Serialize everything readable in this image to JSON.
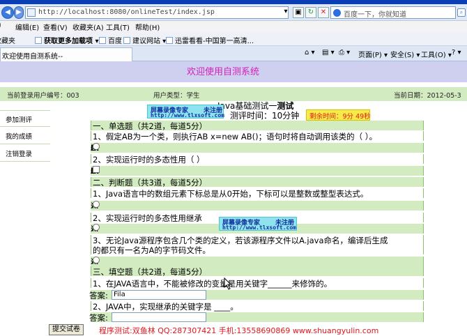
{
  "browser": {
    "url": "http://localhost:8080/onlineTest/index.jsp",
    "search_placeholder": "百度一下，你就知道",
    "menu": [
      "编辑(E)",
      "查看(V)",
      "收藏夹(A)",
      "工具(T)",
      "帮助(H)"
    ],
    "favorites": [
      "收藏夹",
      "获取更多加载项",
      "百度",
      "建议网站",
      "迅雷看看-中国第一高清..."
    ],
    "tab_title": "欢迎使用自测系统--",
    "tools": [
      "页面(P)",
      "安全(S)",
      "工具(O)"
    ]
  },
  "page": {
    "banner": "欢迎使用自测系统",
    "user_id_label": "当前登录用户编号：003",
    "user_type_label": "用户类型：学生",
    "date_label": "当前日期：2012-05-3",
    "sidebar": [
      "参加测评",
      "我的成绩",
      "注销登录"
    ],
    "test_title_prefix": "Java基础测试一",
    "test_title_suffix": "测试",
    "test_time": "测评时间：10分钟",
    "remaining": "剩余时间：9分 49秒",
    "watermark": {
      "name": "屏幕录像专家",
      "status": "未注册",
      "url": "http://www.tlxsoft.com"
    },
    "sections": {
      "single": "一、单选题（共2道，每道5分）",
      "judge": "二、判断题（共3道，每道5分）",
      "fill": "三、填空题（共2道，每道5分）"
    },
    "questions": {
      "s1": "1、假定AB为一个类，则执行AB x=new AB()；语句时将自动调用该类的（ ）。",
      "s2": "2、实现运行时的多态性用（ ）",
      "j1": "1、Java语言中的数组元素下标总是从0开始，下标可以是整数或整型表达式。",
      "j2": "2、实现运行时的多态性用继承",
      "j3a": "3、无论Java源程序包含几个类的定义，若该源程序文件以A.java命名，编译后生成",
      "j3b": "的都只有一名为A的字节码文件。",
      "f1": "1、在JAVA语言中，不能被修改的变量是用关键字______来修饰的。",
      "f2": "2、JAVA中，实现继承的关键字是 ____。"
    },
    "options": {
      "a": "A:",
      "b": "B:",
      "c": "C:",
      "d": "D:"
    },
    "judge_options": {
      "yes": "√:",
      "no": "X:"
    },
    "answer_label": "答案:",
    "answer1_value": "Fila",
    "answer2_value": "",
    "submit_label": "提交试卷",
    "footer": "程序测试:双鱼林 QQ:287307421 手机:13558690869 www.shuangyulin.com"
  },
  "colors": {
    "banner_bg": "#cfd0f0",
    "banner_text": "#d21fb7",
    "row_bg": "#d3ebc1",
    "timer_bg": "#f7ec47",
    "timer_text": "#e0161b",
    "footer_text": "#e0161b"
  }
}
